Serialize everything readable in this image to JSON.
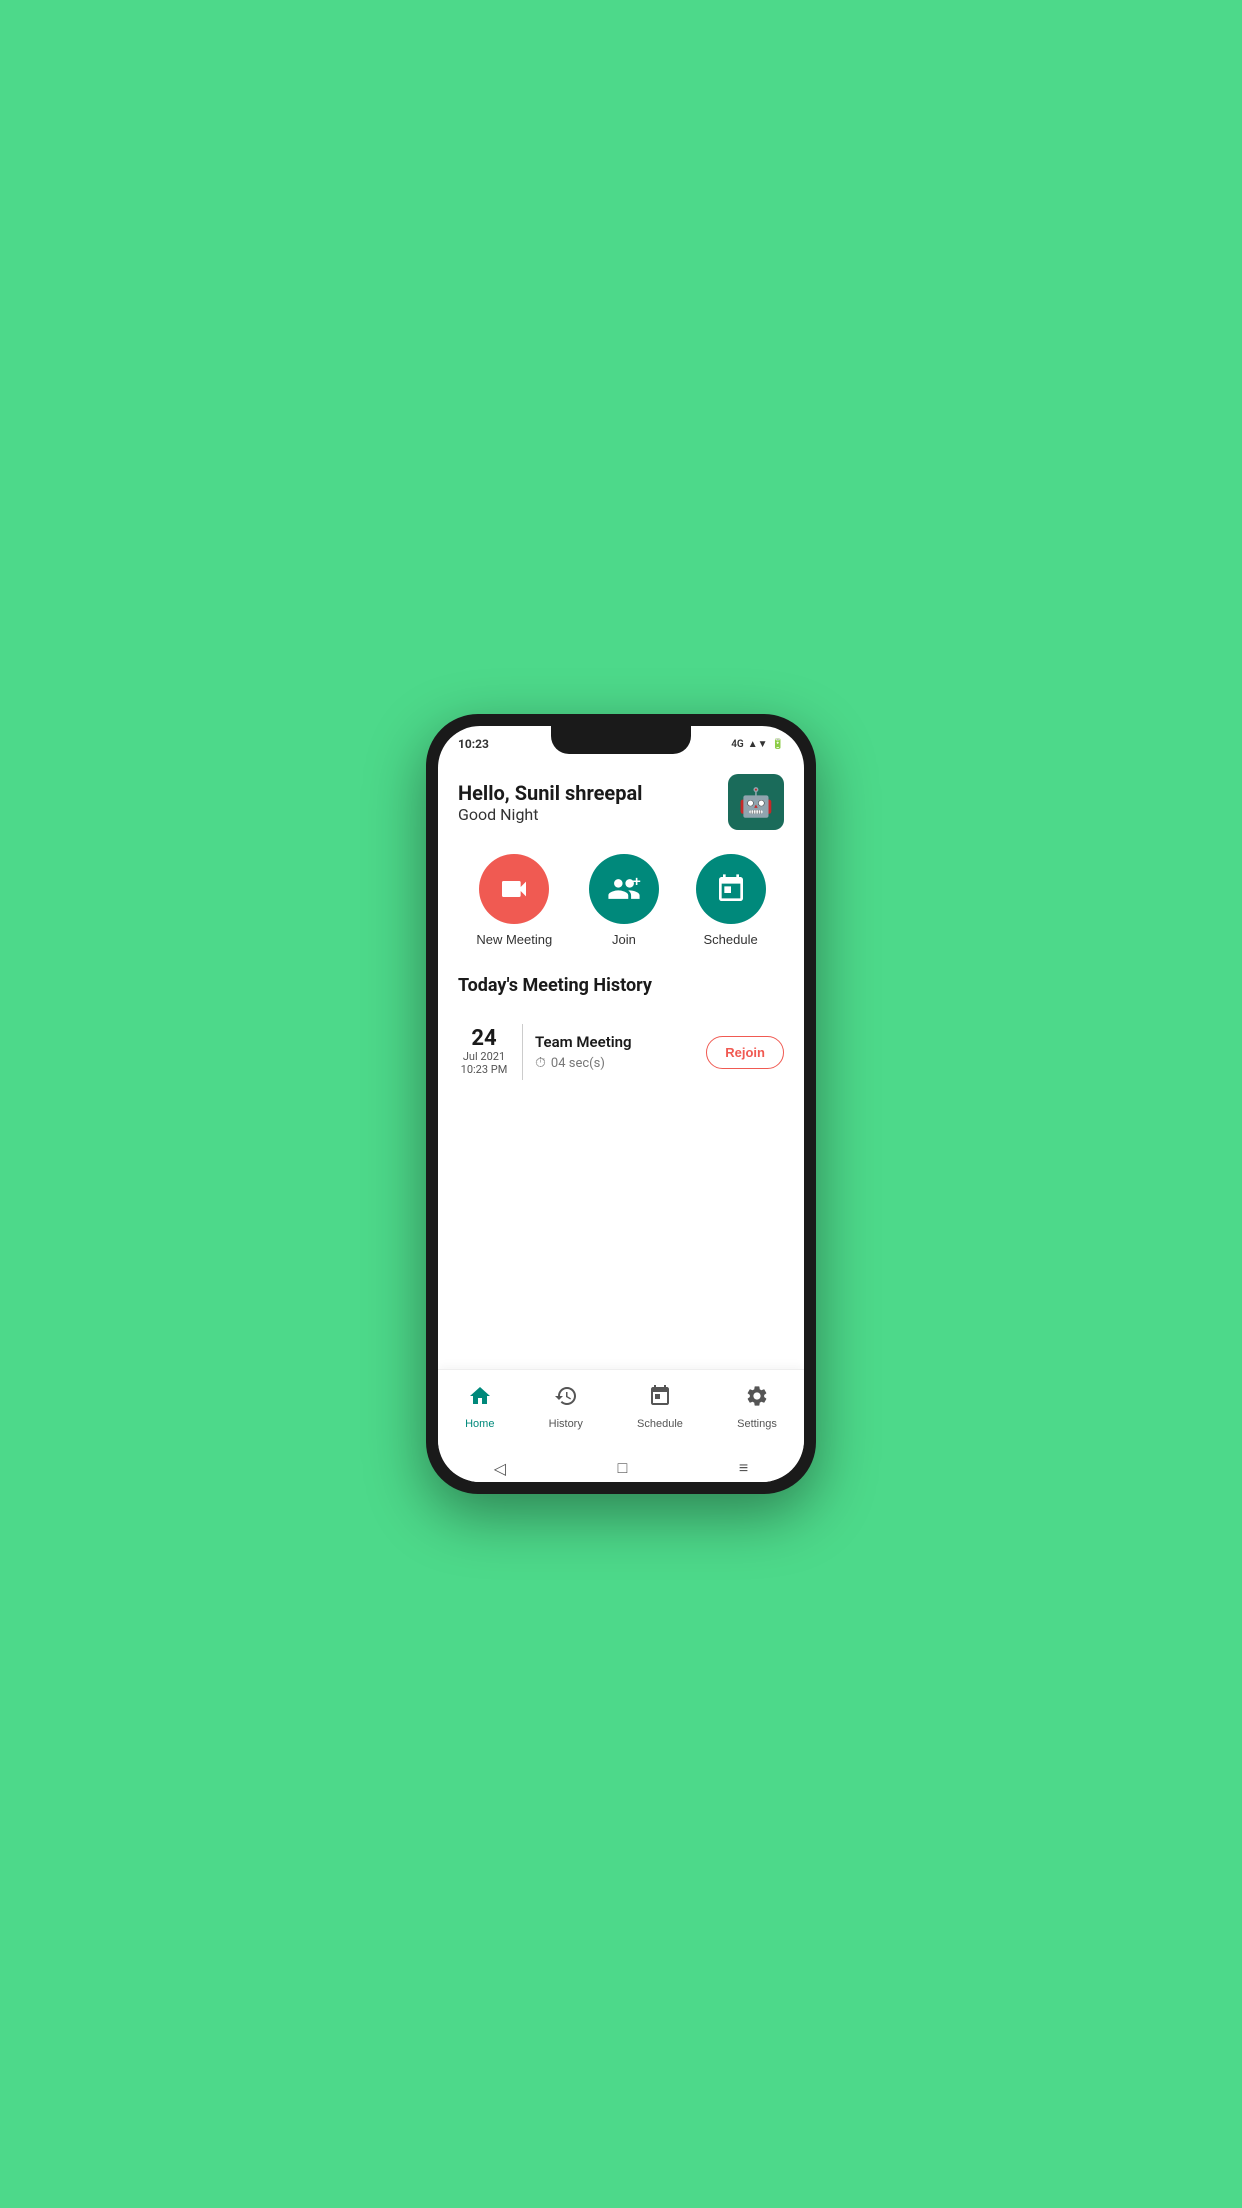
{
  "statusBar": {
    "time": "10:23",
    "icons": "4G ▲▼ 🔋"
  },
  "header": {
    "greeting": "Hello, Sunil shreepal",
    "subGreeting": "Good Night",
    "avatarEmoji": "🤖"
  },
  "actions": [
    {
      "id": "new-meeting",
      "label": "New Meeting",
      "icon": "📹",
      "colorClass": "btn-red"
    },
    {
      "id": "join",
      "label": "Join",
      "icon": "👥+",
      "colorClass": "btn-teal"
    },
    {
      "id": "schedule",
      "label": "Schedule",
      "icon": "📅",
      "colorClass": "btn-teal"
    }
  ],
  "sectionTitle": "Today's Meeting History",
  "meetings": [
    {
      "day": "24",
      "monthYear": "Jul 2021",
      "time": "10:23 PM",
      "name": "Team Meeting",
      "duration": "04 sec(s)",
      "rejoinLabel": "Rejoin"
    }
  ],
  "bottomNav": [
    {
      "id": "home",
      "label": "Home",
      "icon": "🏠",
      "active": true
    },
    {
      "id": "history",
      "label": "History",
      "icon": "🕐",
      "active": false
    },
    {
      "id": "schedule",
      "label": "Schedule",
      "icon": "📅",
      "active": false
    },
    {
      "id": "settings",
      "label": "Settings",
      "icon": "⚙️",
      "active": false
    }
  ],
  "systemNav": {
    "back": "◁",
    "home": "□",
    "recent": "≡"
  }
}
